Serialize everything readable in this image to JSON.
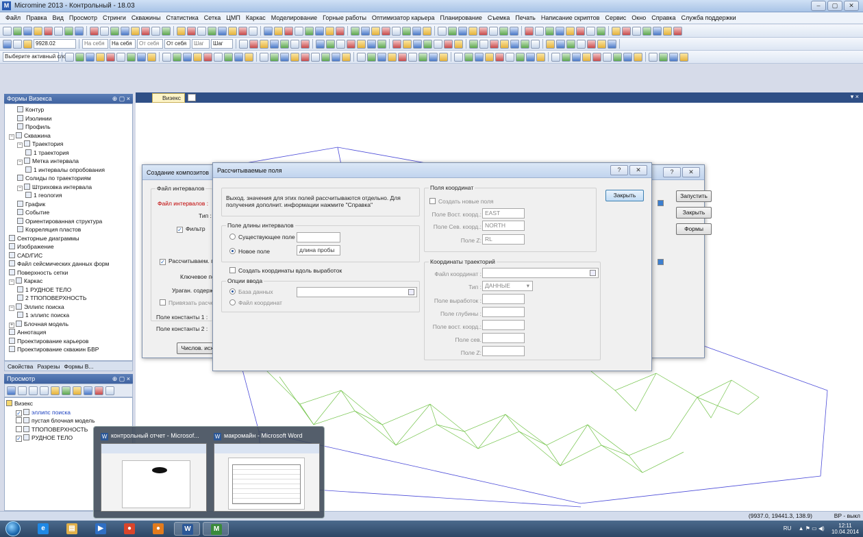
{
  "window": {
    "title": "Micromine 2013 - Контрольный - 18.03",
    "app_icon": "M",
    "buttons": [
      "–",
      "▢",
      "✕"
    ]
  },
  "menu": [
    "Файл",
    "Правка",
    "Вид",
    "Просмотр",
    "Стринги",
    "Скважины",
    "Статистика",
    "Сетка",
    "ЦМП",
    "Каркас",
    "Моделирование",
    "Горные работы",
    "Оптимизатор карьера",
    "Планирование",
    "Съемка",
    "Печать",
    "Написание скриптов",
    "Сервис",
    "Окно",
    "Справка",
    "Служба поддержки"
  ],
  "toolbar2": {
    "coord_value": "9928.02",
    "chips": [
      "На себя",
      "На себя",
      "От себя",
      "От себя",
      "Шаг",
      "Шаг"
    ]
  },
  "toolbar3": {
    "active_layer": "Выберите активный слой"
  },
  "forms_panel": {
    "title": "Формы Визекса",
    "items": [
      {
        "label": "Контур",
        "indent": 1
      },
      {
        "label": "Изолинии",
        "indent": 1
      },
      {
        "label": "Профиль",
        "indent": 1
      },
      {
        "label": "Скважина",
        "indent": 0,
        "exp": "−"
      },
      {
        "label": "Траектория",
        "indent": 1,
        "exp": "−"
      },
      {
        "label": "1 траектория",
        "indent": 2
      },
      {
        "label": "Метка интервала",
        "indent": 1,
        "exp": "−"
      },
      {
        "label": "1 интервалы опробования",
        "indent": 2
      },
      {
        "label": "Солиды по траекториям",
        "indent": 1
      },
      {
        "label": "Штриховка интервала",
        "indent": 1,
        "exp": "−"
      },
      {
        "label": "1 геология",
        "indent": 2
      },
      {
        "label": "График",
        "indent": 1
      },
      {
        "label": "Событие",
        "indent": 1
      },
      {
        "label": "Ориентированная структура",
        "indent": 1
      },
      {
        "label": "Корреляция пластов",
        "indent": 1
      },
      {
        "label": "Секторные диаграммы",
        "indent": 0
      },
      {
        "label": "Изображение",
        "indent": 0
      },
      {
        "label": "CAD/ГИС",
        "indent": 0
      },
      {
        "label": "Файл сейсмических данных форм",
        "indent": 0
      },
      {
        "label": "Поверхность сетки",
        "indent": 0
      },
      {
        "label": "Каркас",
        "indent": 0,
        "exp": "−"
      },
      {
        "label": "1 РУДНОЕ ТЕЛО",
        "indent": 1
      },
      {
        "label": "2 ТПОПОВЕРХНОСТЬ",
        "indent": 1
      },
      {
        "label": "Эллипс поиска",
        "indent": 0,
        "exp": "−"
      },
      {
        "label": "1 эллипс поиска",
        "indent": 1
      },
      {
        "label": "Блочная модель",
        "indent": 0,
        "exp": "+"
      },
      {
        "label": "Аннотация",
        "indent": 0
      },
      {
        "label": "Проектирование карьеров",
        "indent": 0
      },
      {
        "label": "Проектирование скважин БВР",
        "indent": 0
      }
    ],
    "tabs": [
      "Свойства",
      "Разрезы",
      "Формы В..."
    ]
  },
  "view_panel": {
    "title": "Просмотр",
    "root": "Визекс",
    "items": [
      {
        "label": "эллипс поиска",
        "checked": true,
        "blue": true
      },
      {
        "label": "пустая блочная модель",
        "checked": false,
        "blue": false
      },
      {
        "label": "ТПОПОВЕРХНОСТЬ",
        "checked": false,
        "blue": false
      },
      {
        "label": "РУДНОЕ ТЕЛО",
        "checked": true,
        "blue": false
      }
    ]
  },
  "doc_tab": {
    "label": "Визекс",
    "close": "×"
  },
  "composite_dialog": {
    "title": "Создание композитов",
    "file_section": "Файл интервалов",
    "file_label": "Файл интервалов :",
    "type_label": "Тип :",
    "filter_label": "Фильтр",
    "calc_label": "Рассчитываем. п",
    "key_field": "Ключевое поле :",
    "uragan": "Ураган. содерж :",
    "bind": "Привязать расче",
    "const1": "Поле константы 1 :",
    "const2": "Поле константы 2 :",
    "num_button": "Числов. исх",
    "run_button": "Запустить",
    "close_button": "Закрыть",
    "forms_button": "Формы"
  },
  "calc_dialog": {
    "title": "Рассчитываемые поля",
    "info": "Выход. значения для этих полей рассчитываются отдельно. Для получения дополнит. информации нажмите \"Справка\"",
    "length_group": "Поле длины интервалов",
    "existing_field": "Существующее поле",
    "new_field": "Новое поле",
    "new_field_value": "длина пробы",
    "create_coords": "Создать координаты вдоль выработок",
    "input_options": "Опции ввода",
    "database": "База данных",
    "coord_file": "Файл координат",
    "coord_group": "Поля координат",
    "create_new_fields": "Создать новые поля",
    "east_label": "Поле Вост. коорд.:",
    "east_value": "EAST",
    "north_label": "Поле Сев. коорд.:",
    "north_value": "NORTH",
    "z_label": "Поле Z:",
    "z_value": "RL",
    "traj_group": "Координаты траекторий",
    "traj_file": "Файл координат :",
    "traj_type": "Тип :",
    "traj_type_value": "ДАННЫЕ",
    "traj_workings": "Поле выработок :",
    "traj_depth": "Поле глубины :",
    "traj_east": "Поле вост. коорд.:",
    "traj_north": "Поле сев.",
    "traj_z": "Поле Z:",
    "close_button": "Закрыть"
  },
  "thumbnails": [
    {
      "title": "контрольный отчет - Microsof...",
      "icon": "W"
    },
    {
      "title": "макромайн - Microsoft Word",
      "icon": "W"
    }
  ],
  "status": {
    "coords": "(9937.0, 19441.3, 138.9)",
    "mode": "ВР - выкл"
  },
  "tray": {
    "lang": "RU",
    "time": "12:11",
    "date": "10.04.2014"
  },
  "taskbar_apps": [
    {
      "name": "ie",
      "glyph": "e",
      "color": "#1e88e5"
    },
    {
      "name": "explorer",
      "glyph": "▤",
      "color": "#e0b04a"
    },
    {
      "name": "media",
      "glyph": "▶",
      "color": "#2f6fc4"
    },
    {
      "name": "chrome",
      "glyph": "●",
      "color": "#d9452b"
    },
    {
      "name": "firefox",
      "glyph": "●",
      "color": "#e27b1d"
    },
    {
      "name": "word",
      "glyph": "W",
      "color": "#2b5797"
    },
    {
      "name": "micromine",
      "glyph": "M",
      "color": "#3a8a3a"
    }
  ]
}
